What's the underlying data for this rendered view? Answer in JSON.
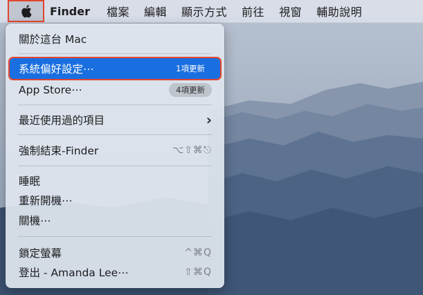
{
  "menubar": {
    "apple_icon": "apple-logo-icon",
    "app_name": "Finder",
    "items": [
      "檔案",
      "編輯",
      "顯示方式",
      "前往",
      "視窗",
      "輔助說明"
    ]
  },
  "apple_menu": {
    "about": "關於這台 Mac",
    "system_prefs": {
      "label": "系統偏好設定⋯",
      "badge": "1項更新"
    },
    "app_store": {
      "label": "App Store⋯",
      "badge": "4項更新"
    },
    "recent_items": {
      "label": "最近使用過的項目",
      "chevron": "›"
    },
    "force_quit": {
      "label": "強制結束-Finder",
      "shortcut": "⌥⇧⌘⎋"
    },
    "sleep": "睡眠",
    "restart": "重新開機⋯",
    "shutdown": "關機⋯",
    "lock_screen": {
      "label": "鎖定螢幕",
      "shortcut": "^⌘Q"
    },
    "logout": {
      "label": "登出 - Amanda Lee⋯",
      "shortcut": "⇧⌘Q"
    }
  },
  "colors": {
    "highlight": "#1a6fe0",
    "annotation_outline": "#e2452f"
  }
}
